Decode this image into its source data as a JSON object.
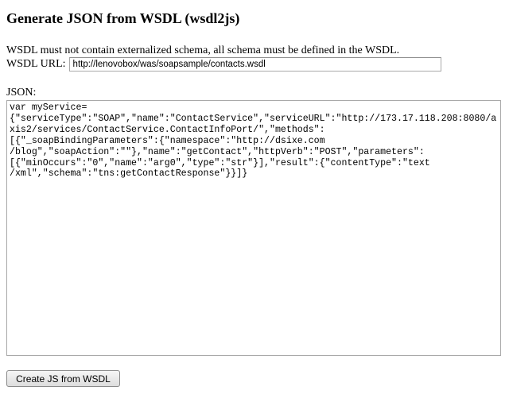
{
  "page": {
    "title": "Generate JSON from WSDL (wsdl2js)",
    "note": "WSDL must not contain externalized schema, all schema must be defined in the WSDL."
  },
  "wsdl_url": {
    "label": "WSDL URL:",
    "value": "http://lenovobox/was/soapsample/contacts.wsdl"
  },
  "json_output": {
    "label": "JSON:",
    "value": "var myService=\n{\"serviceType\":\"SOAP\",\"name\":\"ContactService\",\"serviceURL\":\"http://173.17.118.208:8080/axis2/services/ContactService.ContactInfoPort/\",\"methods\":\n[{\"_soapBindingParameters\":{\"namespace\":\"http://dsixe.com\n/blog\",\"soapAction\":\"\"},\"name\":\"getContact\",\"httpVerb\":\"POST\",\"parameters\":\n[{\"minOccurs\":\"0\",\"name\":\"arg0\",\"type\":\"str\"}],\"result\":{\"contentType\":\"text\n/xml\",\"schema\":\"tns:getContactResponse\"}}]}"
  },
  "actions": {
    "create_button_label": "Create JS from WSDL"
  }
}
